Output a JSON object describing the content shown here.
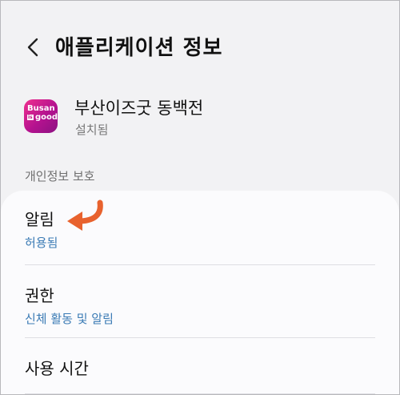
{
  "header": {
    "back_icon": "chevron-left-icon",
    "title": "애플리케이션 정보"
  },
  "app": {
    "icon_name": "busan-is-good-app-icon",
    "icon_text_line1": "Busan",
    "icon_text_badge": "is",
    "icon_text_line2": "good",
    "name": "부산이즈굿 동백전",
    "status": "설치됨"
  },
  "section": {
    "title": "개인정보 보호"
  },
  "items": [
    {
      "title": "알림",
      "subtitle": "허용됨"
    },
    {
      "title": "권한",
      "subtitle": "신체 활동 및 알림"
    },
    {
      "title": "사용 시간"
    }
  ],
  "annotation": {
    "icon_name": "curved-arrow-icon",
    "color": "#e8622e"
  },
  "colors": {
    "accent_link": "#3b7bb5",
    "background": "#f2f2f4",
    "card": "#fbfbfd"
  }
}
